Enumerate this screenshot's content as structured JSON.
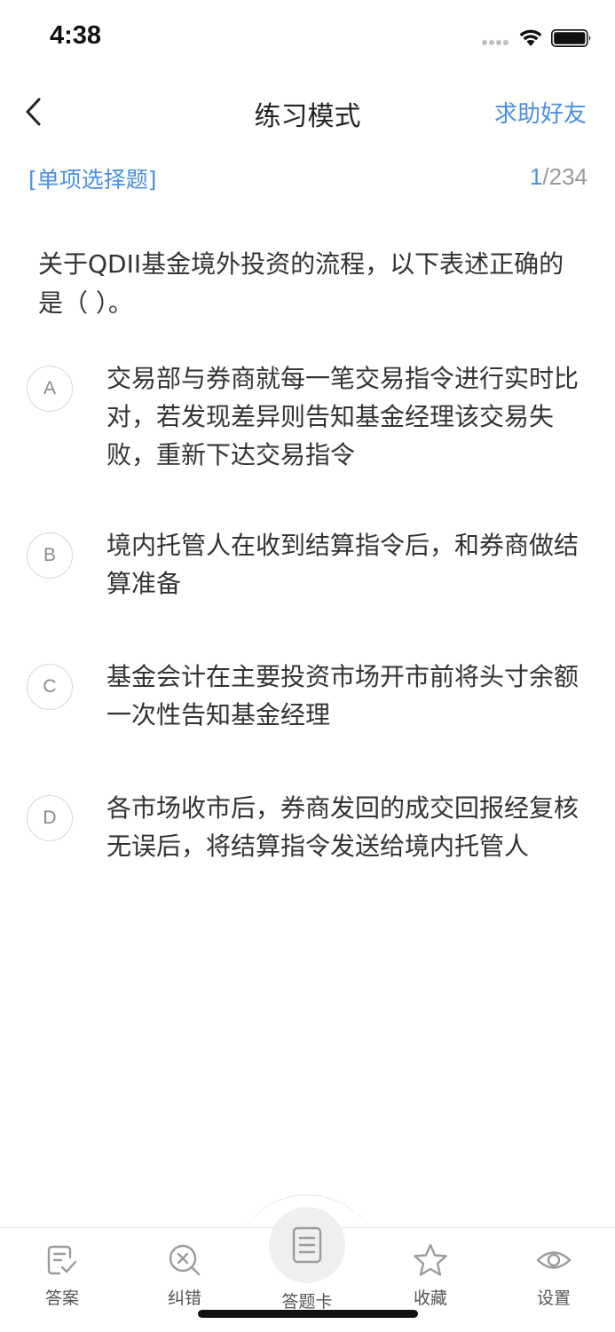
{
  "status_bar": {
    "time": "4:38"
  },
  "nav": {
    "title": "练习模式",
    "help_label": "求助好友"
  },
  "question": {
    "type_label": "[单项选择题]",
    "current": "1",
    "total": "/234",
    "stem": "关于QDII基金境外投资的流程，以下表述正确的是（    ）。",
    "options": [
      {
        "letter": "A",
        "text": "交易部与券商就每一笔交易指令进行实时比对，若发现差异则告知基金经理该交易失败，重新下达交易指令"
      },
      {
        "letter": "B",
        "text": "境内托管人在收到结算指令后，和券商做结算准备"
      },
      {
        "letter": "C",
        "text": "基金会计在主要投资市场开市前将头寸余额一次性告知基金经理"
      },
      {
        "letter": "D",
        "text": "各市场收市后，券商发回的成交回报经复核无误后，将结算指令发送给境内托管人"
      }
    ]
  },
  "bottom_bar": {
    "answer_label": "答案",
    "correct_label": "纠错",
    "card_label": "答题卡",
    "favorite_label": "收藏",
    "settings_label": "设置"
  },
  "colors": {
    "accent": "#4a90e2",
    "icon_gray": "#9b9b9b",
    "text": "#333333"
  }
}
